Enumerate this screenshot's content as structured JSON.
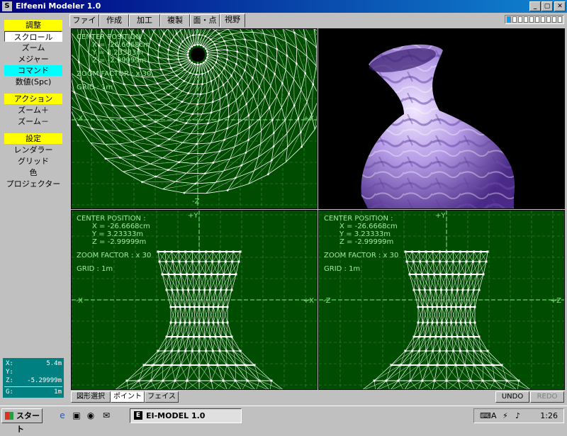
{
  "window": {
    "title": "Elfeeni Modeler 1.0",
    "min": "_",
    "max": "▢",
    "close": "✕",
    "icon": "S"
  },
  "sidebar": {
    "items": [
      {
        "label": "調整",
        "style": "hdr-y"
      },
      {
        "label": "スクロール",
        "style": "sel"
      },
      {
        "label": "ズーム",
        "style": ""
      },
      {
        "label": "メジャー",
        "style": ""
      },
      {
        "label": "コマンド",
        "style": "hdr-c"
      },
      {
        "label": "数値(Spc)",
        "style": ""
      },
      {
        "label": "アクション",
        "style": "hdr-y"
      },
      {
        "label": "ズーム＋",
        "style": ""
      },
      {
        "label": "ズーム－",
        "style": ""
      },
      {
        "label": "設定",
        "style": "hdr-y"
      },
      {
        "label": "レンダラー",
        "style": ""
      },
      {
        "label": "グリッド",
        "style": ""
      },
      {
        "label": "色",
        "style": ""
      },
      {
        "label": "プロジェクター",
        "style": ""
      }
    ]
  },
  "coords": {
    "x_label": "X:",
    "x": "5.4m",
    "y_label": "Y:",
    "y": "",
    "z_label": "Z:",
    "z": "-5.29999m",
    "g_label": "G:",
    "g": "1m"
  },
  "tabs": [
    {
      "label": "ファイル"
    },
    {
      "label": "作成"
    },
    {
      "label": "加工"
    },
    {
      "label": "複製"
    },
    {
      "label": "面・点"
    },
    {
      "label": "視野"
    }
  ],
  "active_tab": "視野",
  "progress": {
    "filled": 1,
    "total": 10
  },
  "viewports": {
    "top": {
      "center_title": "CENTER POSITION :",
      "x": "X = -26.6668cm",
      "y": "Y = 3.23333m",
      "z": "Z = -2.99999m",
      "zoom": "ZOOM FACTOR :  x 30",
      "grid": "GRID : 1m",
      "axis_left": "-X",
      "axis_right": "+X",
      "axis_bottom": "-Z"
    },
    "front": {
      "center_title": "CENTER POSITION :",
      "x": "X = -26.6668cm",
      "y": "Y = 3.23333m",
      "z": "Z = -2.99999m",
      "zoom": "ZOOM FACTOR :  x 30",
      "grid": "GRID : 1m",
      "axis_top": "+Y",
      "axis_left": "-X",
      "axis_right": "+X"
    },
    "side": {
      "center_title": "CENTER POSITION :",
      "x": "X = -26.6668cm",
      "y": "Y = 3.23333m",
      "z": "Z = -2.99999m",
      "zoom": "ZOOM FACTOR :  x 30",
      "grid": "GRID : 1m",
      "axis_top": "+Y",
      "axis_left": "-Z",
      "axis_right": "+Z"
    }
  },
  "bottom_tabs": [
    {
      "label": "図形選択"
    },
    {
      "label": "ポイント"
    },
    {
      "label": "フェイス"
    }
  ],
  "undo_label": "UNDO",
  "redo_label": "REDO",
  "taskbar": {
    "start": "スタート",
    "task": "EI-MODEL 1.0",
    "clock": "1:26"
  },
  "colors": {
    "viewport_bg": "#004c00",
    "wire": "#ffffff",
    "grid": "#66bb66",
    "vase": "#b59be6"
  }
}
